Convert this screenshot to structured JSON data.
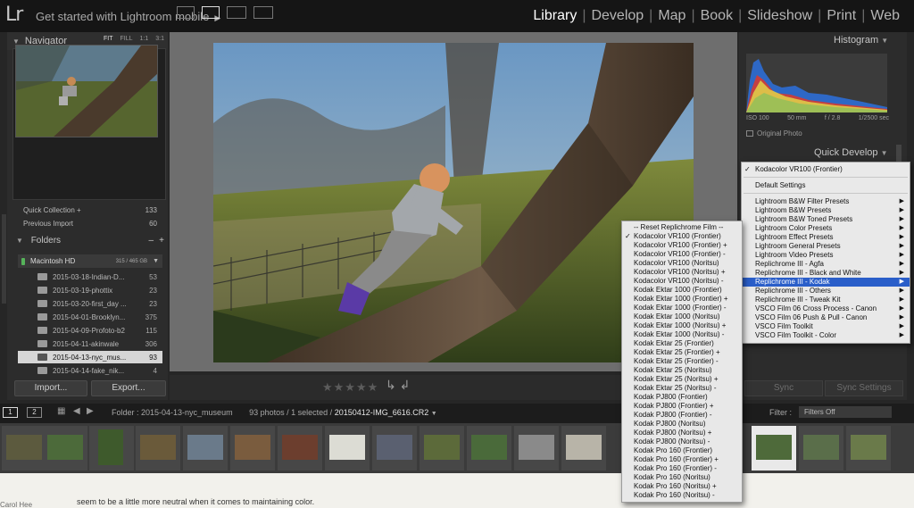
{
  "app": {
    "logo": "Lr",
    "mobile_promo": "Get started with Lightroom mobile",
    "modules": [
      "Library",
      "Develop",
      "Map",
      "Book",
      "Slideshow",
      "Print",
      "Web"
    ],
    "active_module": "Library"
  },
  "left_panel": {
    "navigator": {
      "title": "Navigator",
      "zoom_options": [
        "FIT",
        "FILL",
        "1:1",
        "3:1"
      ]
    },
    "catalog": [
      {
        "label": "Quick Collection +",
        "count": "133"
      },
      {
        "label": "Previous Import",
        "count": "60"
      }
    ],
    "folders": {
      "title": "Folders",
      "controls": [
        "–",
        "+"
      ],
      "volume": {
        "name": "Macintosh HD",
        "size": "315 / 465 GB"
      },
      "items": [
        {
          "name": "2015-03-18-Indian-D...",
          "count": "53"
        },
        {
          "name": "2015-03-19-phottix",
          "count": "23"
        },
        {
          "name": "2015-03-20-first_day ...",
          "count": "23"
        },
        {
          "name": "2015-04-01-Brooklyn...",
          "count": "375"
        },
        {
          "name": "2015-04-09-Profoto-b2",
          "count": "115"
        },
        {
          "name": "2015-04-11-akinwale",
          "count": "306"
        },
        {
          "name": "2015-04-13-nyc_mus...",
          "count": "93",
          "selected": true
        },
        {
          "name": "2015-04-14-fake_nik...",
          "count": "4"
        }
      ]
    },
    "import_button": "Import...",
    "export_button": "Export..."
  },
  "right_panel": {
    "histogram": {
      "title": "Histogram",
      "iso": "ISO 100",
      "focal": "50 mm",
      "aperture": "f / 2.8",
      "shutter": "1/2500 sec",
      "original_photo": "Original Photo"
    },
    "quick_develop": {
      "title": "Quick Develop"
    },
    "sync_button": "Sync",
    "sync_settings_button": "Sync Settings"
  },
  "filmstrip_bar": {
    "pages": [
      "1",
      "2"
    ],
    "folder": "Folder : 2015-04-13-nyc_museum",
    "count": "93 photos / 1 selected /",
    "filename": "20150412-IMG_6616.CR2",
    "filter_label": "Filter :",
    "filter_value": "Filters Off"
  },
  "bottom_text": "seem to be a little more neutral when it comes to maintaining color.",
  "bottom_left": "Carol Hee",
  "preset_menu": {
    "current": "Kodacolor VR100 (Frontier)",
    "default": "Default Settings",
    "items": [
      "Lightroom B&W Filter Presets",
      "Lightroom B&W Presets",
      "Lightroom B&W Toned Presets",
      "Lightroom Color Presets",
      "Lightroom Effect Presets",
      "Lightroom General Presets",
      "Lightroom Video Presets",
      "Replichrome III - Agfa",
      "Replichrome III - Black and White",
      "Replichrome III - Kodak",
      "Replichrome III - Others",
      "Replichrome III - Tweak Kit",
      "VSCO Film 06 Cross Process - Canon",
      "VSCO Film 06 Push & Pull - Canon",
      "VSCO Film Toolkit",
      "VSCO Film Toolkit - Color"
    ],
    "highlighted": "Replichrome III - Kodak"
  },
  "kodak_submenu": {
    "items": [
      "-- Reset Replichrome Film --",
      "Kodacolor VR100 (Frontier)",
      "Kodacolor VR100 (Frontier) +",
      "Kodacolor VR100 (Frontier) -",
      "Kodacolor VR100 (Noritsu)",
      "Kodacolor VR100 (Noritsu) +",
      "Kodacolor VR100 (Noritsu) -",
      "Kodak Ektar 1000 (Frontier)",
      "Kodak Ektar 1000 (Frontier) +",
      "Kodak Ektar 1000 (Frontier) -",
      "Kodak Ektar 1000 (Noritsu)",
      "Kodak Ektar 1000 (Noritsu) +",
      "Kodak Ektar 1000 (Noritsu) -",
      "Kodak Ektar 25 (Frontier)",
      "Kodak Ektar 25 (Frontier) +",
      "Kodak Ektar 25 (Frontier) -",
      "Kodak Ektar 25 (Noritsu)",
      "Kodak Ektar 25 (Noritsu) +",
      "Kodak Ektar 25 (Noritsu) -",
      "Kodak PJ800 (Frontier)",
      "Kodak PJ800 (Frontier) +",
      "Kodak PJ800 (Frontier) -",
      "Kodak PJ800 (Noritsu)",
      "Kodak PJ800 (Noritsu) +",
      "Kodak PJ800 (Noritsu) -",
      "Kodak Pro 160 (Frontier)",
      "Kodak Pro 160 (Frontier) +",
      "Kodak Pro 160 (Frontier) -",
      "Kodak Pro 160 (Noritsu)",
      "Kodak Pro 160 (Noritsu) +",
      "Kodak Pro 160 (Noritsu) -"
    ],
    "checked": "Kodacolor VR100 (Frontier)"
  },
  "icons": {
    "rating": "★★★★★",
    "rotate": "rotate-icons"
  },
  "colors": {
    "highlight": "#2a5ec9",
    "selected_folder": "#d6d6d6",
    "active_module": "#ffffff"
  }
}
